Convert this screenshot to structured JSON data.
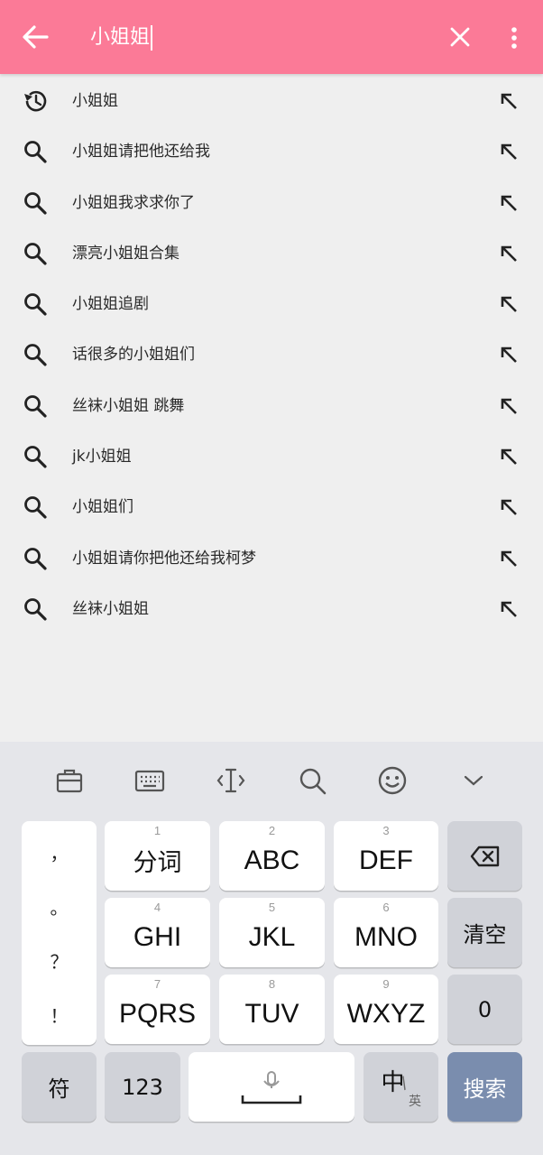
{
  "search": {
    "query": "小姐姐"
  },
  "suggestions": [
    {
      "type": "history",
      "text": "小姐姐"
    },
    {
      "type": "search",
      "text": "小姐姐请把他还给我"
    },
    {
      "type": "search",
      "text": "小姐姐我求求你了"
    },
    {
      "type": "search",
      "text": "漂亮小姐姐合集"
    },
    {
      "type": "search",
      "text": "小姐姐追剧"
    },
    {
      "type": "search",
      "text": "话很多的小姐姐们"
    },
    {
      "type": "search",
      "text": "丝袜小姐姐 跳舞"
    },
    {
      "type": "search",
      "text": "jk小姐姐"
    },
    {
      "type": "search",
      "text": "小姐姐们"
    },
    {
      "type": "search",
      "text": "小姐姐请你把他还给我柯梦"
    },
    {
      "type": "search",
      "text": "丝袜小姐姐"
    }
  ],
  "keyboard": {
    "toolbar_icons": [
      "briefcase-icon",
      "keyboard-icon",
      "text-cursor-icon",
      "search-icon",
      "emoji-icon",
      "chevron-down-icon"
    ],
    "punctuation": [
      "，",
      "。",
      "？",
      "！"
    ],
    "keys": [
      {
        "num": "1",
        "label": "分词"
      },
      {
        "num": "2",
        "label": "ABC"
      },
      {
        "num": "3",
        "label": "DEF"
      },
      {
        "num": "4",
        "label": "GHI"
      },
      {
        "num": "5",
        "label": "JKL"
      },
      {
        "num": "6",
        "label": "MNO"
      },
      {
        "num": "7",
        "label": "PQRS"
      },
      {
        "num": "8",
        "label": "TUV"
      },
      {
        "num": "9",
        "label": "WXYZ"
      }
    ],
    "clear_label": "清空",
    "zero_label": "0",
    "symbol_label": "符",
    "numeric_label": "123",
    "lang_main": "中",
    "lang_sub": "英",
    "search_label": "搜索"
  },
  "colors": {
    "topbar": "#fb7a97",
    "search_key": "#7a8dae"
  }
}
